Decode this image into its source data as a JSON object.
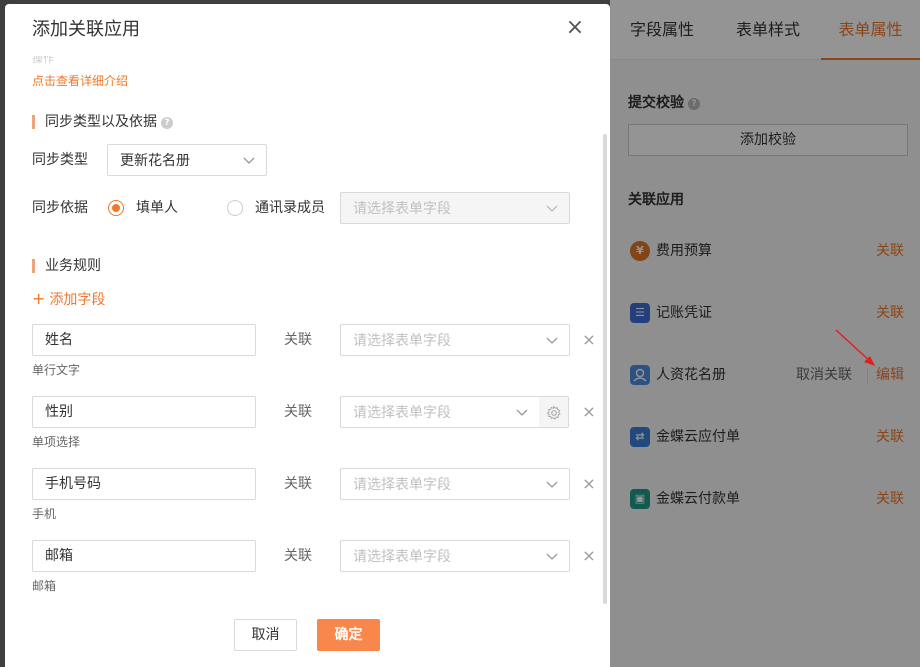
{
  "modal": {
    "title": "添加关联应用",
    "close_glyph": "×",
    "faded_text": "操作",
    "detail_link": "点击查看详细介绍",
    "sync_section": {
      "title": "同步类型以及依据",
      "type_label": "同步类型",
      "type_value": "更新花名册",
      "basis_label": "同步依据",
      "basis_options": [
        {
          "label": "填单人",
          "selected": true
        },
        {
          "label": "通讯录成员",
          "selected": false
        }
      ],
      "basis_select_placeholder": "请选择表单字段"
    },
    "rules_section": {
      "title": "业务规则",
      "add_field": "添加字段",
      "rows": [
        {
          "field": "姓名",
          "type": "单行文字",
          "relation": "关联",
          "placeholder": "请选择表单字段",
          "has_gear": false
        },
        {
          "field": "性别",
          "type": "单项选择",
          "relation": "关联",
          "placeholder": "请选择表单字段",
          "has_gear": true
        },
        {
          "field": "手机号码",
          "type": "手机",
          "relation": "关联",
          "placeholder": "请选择表单字段",
          "has_gear": false
        },
        {
          "field": "邮箱",
          "type": "邮箱",
          "relation": "关联",
          "placeholder": "请选择表单字段",
          "has_gear": false
        }
      ]
    },
    "footer": {
      "cancel": "取消",
      "ok": "确定"
    }
  },
  "right_panel": {
    "tabs": [
      {
        "label": "字段属性",
        "active": false
      },
      {
        "label": "表单样式",
        "active": false
      },
      {
        "label": "表单属性",
        "active": true
      }
    ],
    "submit_check": {
      "title": "提交校验",
      "button": "添加校验"
    },
    "linked_apps": {
      "title": "关联应用",
      "items": [
        {
          "name": "费用预算",
          "action": "关联",
          "icon": "yen-icon",
          "color": "#e0782a"
        },
        {
          "name": "记账凭证",
          "action": "关联",
          "icon": "ledger-icon",
          "color": "#3d6fd6"
        },
        {
          "name": "人资花名册",
          "action": "编辑",
          "secondary_action": "取消关联",
          "icon": "person-icon",
          "color": "#4d8de0"
        },
        {
          "name": "金蝶云应付单",
          "action": "关联",
          "icon": "transfer-icon",
          "color": "#3a7fd9"
        },
        {
          "name": "金蝶云付款单",
          "action": "关联",
          "icon": "wallet-icon",
          "color": "#1f9b8a"
        }
      ]
    }
  },
  "colors": {
    "accent": "#f0782a",
    "annotation_arrow": "#e02020"
  }
}
